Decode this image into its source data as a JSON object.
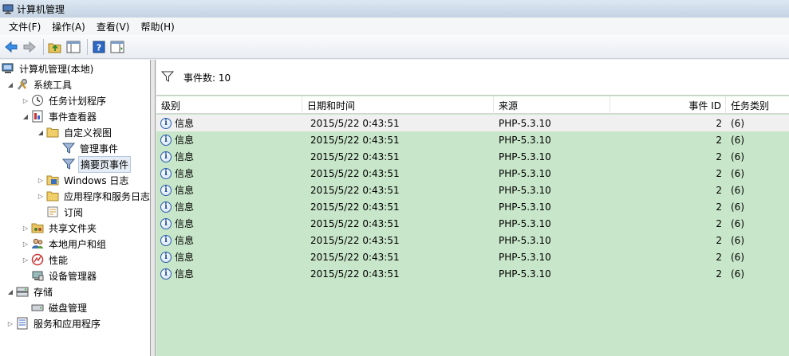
{
  "window": {
    "title": "计算机管理"
  },
  "menu": [
    "文件(F)",
    "操作(A)",
    "查看(V)",
    "帮助(H)"
  ],
  "toolbar": {
    "buttons": [
      "back-icon",
      "forward-icon",
      "up-folder-icon",
      "show-hide-console-tree-icon",
      "help-icon",
      "show-hide-action-pane-icon"
    ]
  },
  "tree": [
    {
      "label": "计算机管理(本地)",
      "icon": "computer-management-icon",
      "expander": ""
    },
    {
      "label": "系统工具",
      "icon": "tools-icon",
      "expander": "expanded"
    },
    {
      "label": "任务计划程序",
      "icon": "clock-icon",
      "expander": "collapsed"
    },
    {
      "label": "事件查看器",
      "icon": "event-viewer-icon",
      "expander": "expanded"
    },
    {
      "label": "自定义视图",
      "icon": "folder-icon",
      "expander": "expanded"
    },
    {
      "label": "管理事件",
      "icon": "filter-icon",
      "expander": ""
    },
    {
      "label": "摘要页事件",
      "icon": "filter-icon",
      "expander": "",
      "selected": true
    },
    {
      "label": "Windows 日志",
      "icon": "folder-icon",
      "expander": "collapsed"
    },
    {
      "label": "应用程序和服务日志",
      "icon": "folder-icon",
      "expander": "collapsed"
    },
    {
      "label": "订阅",
      "icon": "subscriptions-icon",
      "expander": ""
    },
    {
      "label": "共享文件夹",
      "icon": "shared-folder-icon",
      "expander": "collapsed"
    },
    {
      "label": "本地用户和组",
      "icon": "users-icon",
      "expander": "collapsed"
    },
    {
      "label": "性能",
      "icon": "performance-icon",
      "expander": "collapsed"
    },
    {
      "label": "设备管理器",
      "icon": "device-manager-icon",
      "expander": ""
    },
    {
      "label": "存储",
      "icon": "storage-icon",
      "expander": "expanded"
    },
    {
      "label": "磁盘管理",
      "icon": "disk-icon",
      "expander": ""
    },
    {
      "label": "服务和应用程序",
      "icon": "services-icon",
      "expander": "collapsed"
    }
  ],
  "filter_bar": {
    "count_text": "事件数: 10"
  },
  "columns": [
    "级别",
    "日期和时间",
    "来源",
    "事件 ID",
    "任务类别"
  ],
  "rows": [
    {
      "level": "信息",
      "datetime": "2015/5/22 0:43:51",
      "source": "PHP-5.3.10",
      "event_id": "2",
      "category": "(6)"
    },
    {
      "level": "信息",
      "datetime": "2015/5/22 0:43:51",
      "source": "PHP-5.3.10",
      "event_id": "2",
      "category": "(6)"
    },
    {
      "level": "信息",
      "datetime": "2015/5/22 0:43:51",
      "source": "PHP-5.3.10",
      "event_id": "2",
      "category": "(6)"
    },
    {
      "level": "信息",
      "datetime": "2015/5/22 0:43:51",
      "source": "PHP-5.3.10",
      "event_id": "2",
      "category": "(6)"
    },
    {
      "level": "信息",
      "datetime": "2015/5/22 0:43:51",
      "source": "PHP-5.3.10",
      "event_id": "2",
      "category": "(6)"
    },
    {
      "level": "信息",
      "datetime": "2015/5/22 0:43:51",
      "source": "PHP-5.3.10",
      "event_id": "2",
      "category": "(6)"
    },
    {
      "level": "信息",
      "datetime": "2015/5/22 0:43:51",
      "source": "PHP-5.3.10",
      "event_id": "2",
      "category": "(6)"
    },
    {
      "level": "信息",
      "datetime": "2015/5/22 0:43:51",
      "source": "PHP-5.3.10",
      "event_id": "2",
      "category": "(6)"
    },
    {
      "level": "信息",
      "datetime": "2015/5/22 0:43:51",
      "source": "PHP-5.3.10",
      "event_id": "2",
      "category": "(6)"
    },
    {
      "level": "信息",
      "datetime": "2015/5/22 0:43:51",
      "source": "PHP-5.3.10",
      "event_id": "2",
      "category": "(6)"
    }
  ],
  "colors": {
    "row_background": "#c8e6c9",
    "selected_background": "#e5ecf5"
  }
}
